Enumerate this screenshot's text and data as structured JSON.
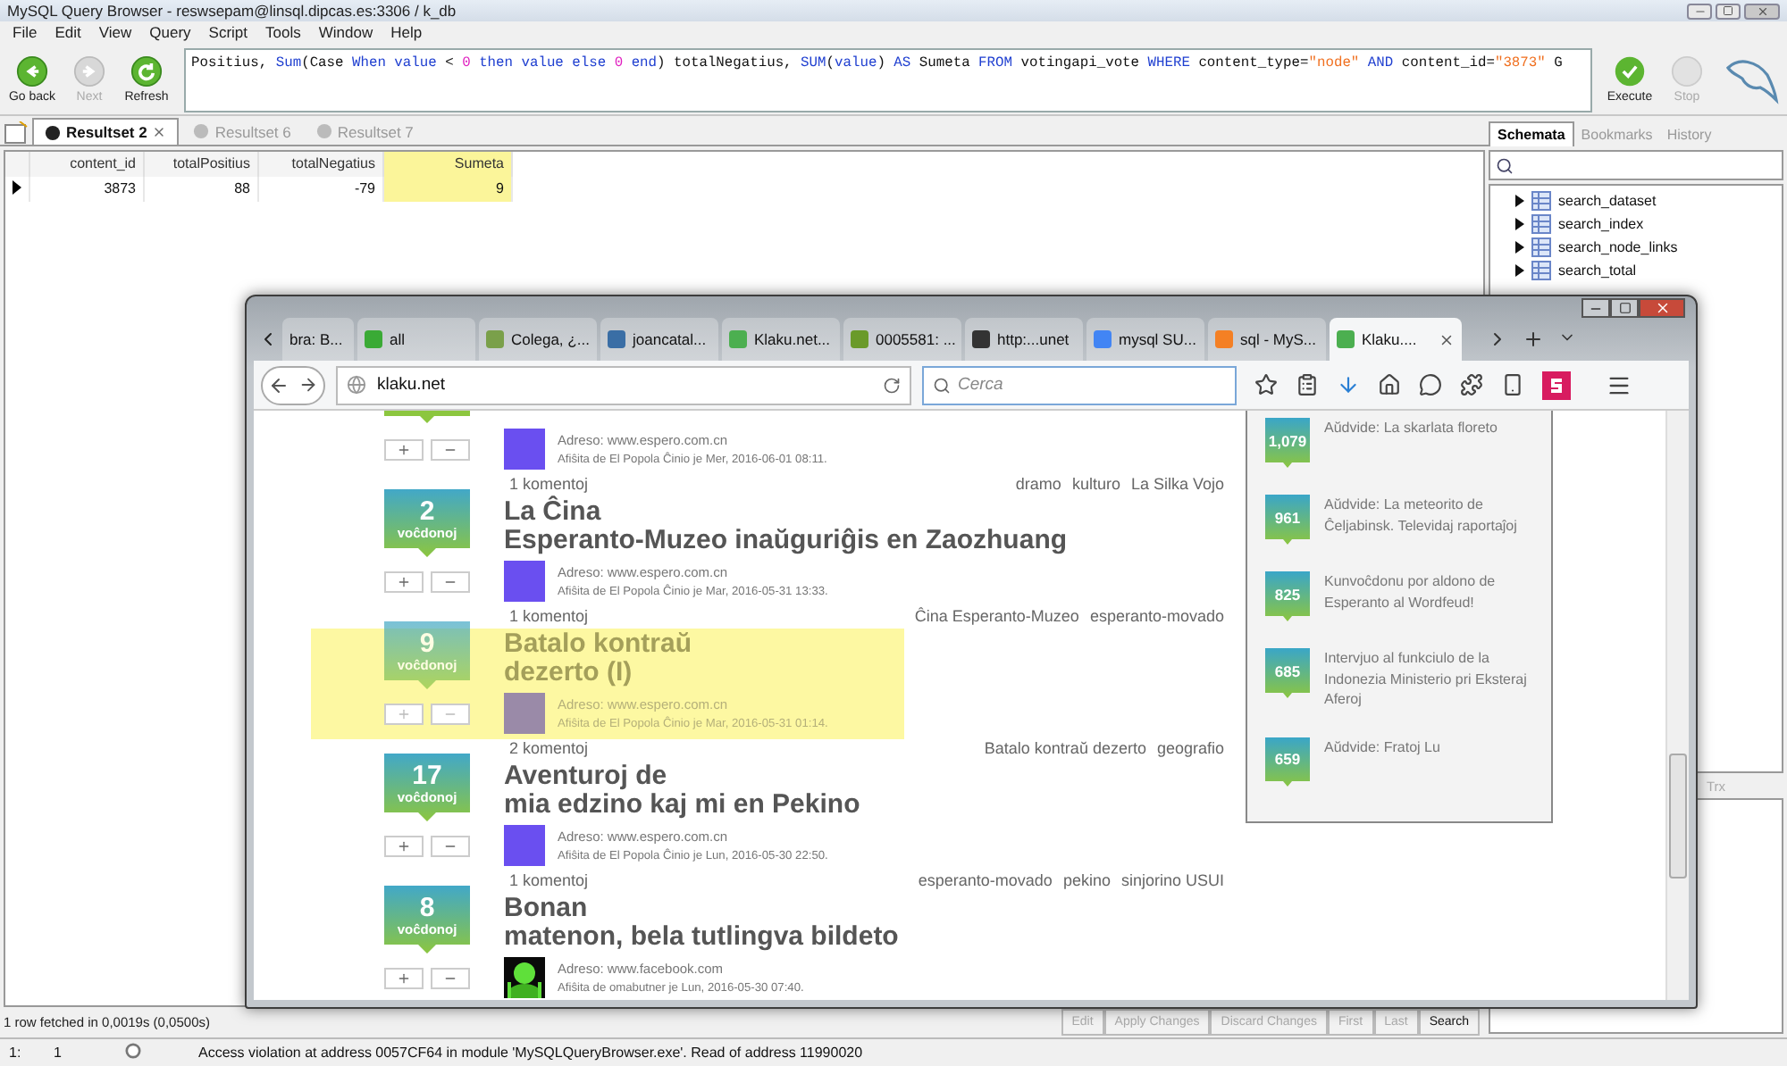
{
  "window": {
    "title": "MySQL Query Browser - reswsepam@linsql.dipcas.es:3306 / k_db"
  },
  "menu": [
    "File",
    "Edit",
    "View",
    "Query",
    "Script",
    "Tools",
    "Window",
    "Help"
  ],
  "toolbar": {
    "buttons": [
      {
        "label": "Go back",
        "kind": "back",
        "disabled": false
      },
      {
        "label": "Next",
        "kind": "next",
        "disabled": true
      },
      {
        "label": "Refresh",
        "kind": "refresh",
        "disabled": false
      }
    ],
    "query": [
      {
        "kind": "plain",
        "text": "Positius, "
      },
      {
        "kind": "keyword",
        "text": "Sum"
      },
      {
        "kind": "plain",
        "text": "(Case "
      },
      {
        "kind": "keyword",
        "text": "When value"
      },
      {
        "kind": "plain",
        "text": " < "
      },
      {
        "kind": "number",
        "text": "0"
      },
      {
        "kind": "keyword",
        "text": " then value else "
      },
      {
        "kind": "number",
        "text": "0"
      },
      {
        "kind": "keyword",
        "text": " end"
      },
      {
        "kind": "plain",
        "text": ") totalNegatius, "
      },
      {
        "kind": "keyword",
        "text": "SUM"
      },
      {
        "kind": "plain",
        "text": "("
      },
      {
        "kind": "keyword",
        "text": "value"
      },
      {
        "kind": "plain",
        "text": ") "
      },
      {
        "kind": "keyword",
        "text": "AS"
      },
      {
        "kind": "plain",
        "text": " Sumeta "
      },
      {
        "kind": "keyword",
        "text": "FROM"
      },
      {
        "kind": "plain",
        "text": " votingapi_vote "
      },
      {
        "kind": "keyword",
        "text": "WHERE"
      },
      {
        "kind": "plain",
        "text": " content_type="
      },
      {
        "kind": "string",
        "text": "\"node\""
      },
      {
        "kind": "keyword",
        "text": " AND"
      },
      {
        "kind": "plain",
        "text": " content_id="
      },
      {
        "kind": "string",
        "text": "\"3873\""
      },
      {
        "kind": "plain",
        "text": " G"
      }
    ],
    "execute": {
      "label": "Execute",
      "disabled": false
    },
    "stop": {
      "label": "Stop",
      "disabled": true
    }
  },
  "result_tabs": [
    {
      "label": "Resultset 2",
      "selected": true
    },
    {
      "label": "Resultset 6",
      "selected": false
    },
    {
      "label": "Resultset 7",
      "selected": false
    }
  ],
  "table": {
    "columns": [
      {
        "label": "content_id",
        "highlighted": false
      },
      {
        "label": "totalPositius",
        "highlighted": false
      },
      {
        "label": "totalNegatius",
        "highlighted": false
      },
      {
        "label": "Sumeta",
        "highlighted": true
      }
    ],
    "rows": [
      [
        "3873",
        "88",
        "-79",
        "9"
      ]
    ]
  },
  "result_status": "1 row fetched in 0,0019s (0,0500s)",
  "result_buttons": [
    {
      "label": "Edit",
      "disabled": true
    },
    {
      "label": "Apply Changes",
      "disabled": true
    },
    {
      "label": "Discard Changes",
      "disabled": true
    },
    {
      "label": "First",
      "disabled": true
    },
    {
      "label": "Last",
      "disabled": true
    },
    {
      "label": "Search",
      "disabled": false
    }
  ],
  "side_tabs": [
    {
      "label": "Schemata",
      "selected": true
    },
    {
      "label": "Bookmarks",
      "selected": false
    },
    {
      "label": "History",
      "selected": false
    }
  ],
  "schema_tables": [
    "search_dataset",
    "search_index",
    "search_node_links",
    "search_total"
  ],
  "lower_panel_tab": "Trx",
  "status_bar": {
    "line": "1:",
    "column": "1",
    "message": "Access violation at address 0057CF64 in module 'MySQLQueryBrowser.exe'. Read of address 11990020"
  },
  "browser": {
    "tabs": [
      {
        "label": "bra: B...",
        "selected": false
      },
      {
        "label": "all",
        "color": "#3aaa35",
        "selected": false
      },
      {
        "label": "Colega, ¿...",
        "color": "#7aa04a",
        "selected": false
      },
      {
        "label": "joancatal...",
        "color": "#3a6ea5",
        "selected": false
      },
      {
        "label": "Klaku.net...",
        "color": "#4caf50",
        "selected": false
      },
      {
        "label": "0005581: ...",
        "color": "#6a9a2a",
        "selected": false
      },
      {
        "label": "http:...unet",
        "color": "#333333",
        "selected": false
      },
      {
        "label": "mysql SU...",
        "color": "#4285f4",
        "selected": false
      },
      {
        "label": "sql - MyS...",
        "color": "#f48024",
        "selected": false
      },
      {
        "label": "Klaku....",
        "color": "#4caf50",
        "selected": true
      }
    ],
    "url": "klaku.net",
    "search_placeholder": "Cerca",
    "posts": [
      {
        "kind": "partial",
        "adreso": "Adreso: www.espero.com.cn",
        "meta": "Afiŝita de El Popola Ĉinio je Mer, 2016-06-01 08:11.",
        "photo_thumb": false,
        "highlighted": false
      },
      {
        "kind": "full",
        "comments": "1 komentoj",
        "tags": [
          "dramo",
          "kulturo",
          "La Silka Vojo"
        ],
        "votes": "2",
        "votes_label": "voĉdonoj",
        "title": [
          "La Ĉina",
          "Esperanto-Muzeo inaŭguriĝis en Zaozhuang"
        ],
        "adreso": "Adreso: www.espero.com.cn",
        "meta": "Afiŝita de El Popola Ĉinio je Mar, 2016-05-31 13:33.",
        "photo_thumb": false,
        "highlighted": false
      },
      {
        "kind": "full",
        "comments": "1 komentoj",
        "tags": [
          "Ĉina Esperanto-Muzeo",
          "esperanto-movado"
        ],
        "votes": "9",
        "votes_label": "voĉdonoj",
        "title": [
          "Batalo kontraŭ",
          "dezerto (I)"
        ],
        "adreso": "Adreso: www.espero.com.cn",
        "meta": "Afiŝita de El Popola Ĉinio je Mar, 2016-05-31 01:14.",
        "photo_thumb": false,
        "highlighted": true
      },
      {
        "kind": "full",
        "comments": "2 komentoj",
        "tags": [
          "Batalo kontraŭ dezerto",
          "geografio"
        ],
        "votes": "17",
        "votes_label": "voĉdonoj",
        "title": [
          "Aventuroj de",
          "mia edzino kaj mi en Pekino"
        ],
        "adreso": "Adreso: www.espero.com.cn",
        "meta": "Afiŝita de El Popola Ĉinio je Lun, 2016-05-30 22:50.",
        "photo_thumb": false,
        "highlighted": false
      },
      {
        "kind": "full",
        "comments": "1 komentoj",
        "tags": [
          "esperanto-movado",
          "pekino",
          "sinjorino USUI"
        ],
        "votes": "8",
        "votes_label": "voĉdonoj",
        "title": [
          "Bonan",
          "matenon, bela tutlingva bildeto"
        ],
        "adreso": "Adreso: www.facebook.com",
        "meta": "Afiŝita de omabutner je Lun, 2016-05-30 07:40.",
        "photo_thumb": true,
        "highlighted": false
      }
    ],
    "popular": [
      {
        "count": "1,079",
        "title": "Aŭdvide: La skarlata floreto"
      },
      {
        "count": "961",
        "title": "Aŭdvide: La meteorito de Ĉeljabinsk. Televidaj raportaĵoj"
      },
      {
        "count": "825",
        "title": "Kunvoĉdonu por aldono de Esperanto al Wordfeud!"
      },
      {
        "count": "685",
        "title": "Intervjuo al funkciulo de la Indonezia Ministerio pri Eksteraj Aferoj"
      },
      {
        "count": "659",
        "title": "Aŭdvide: Fratoj Lu"
      }
    ]
  }
}
